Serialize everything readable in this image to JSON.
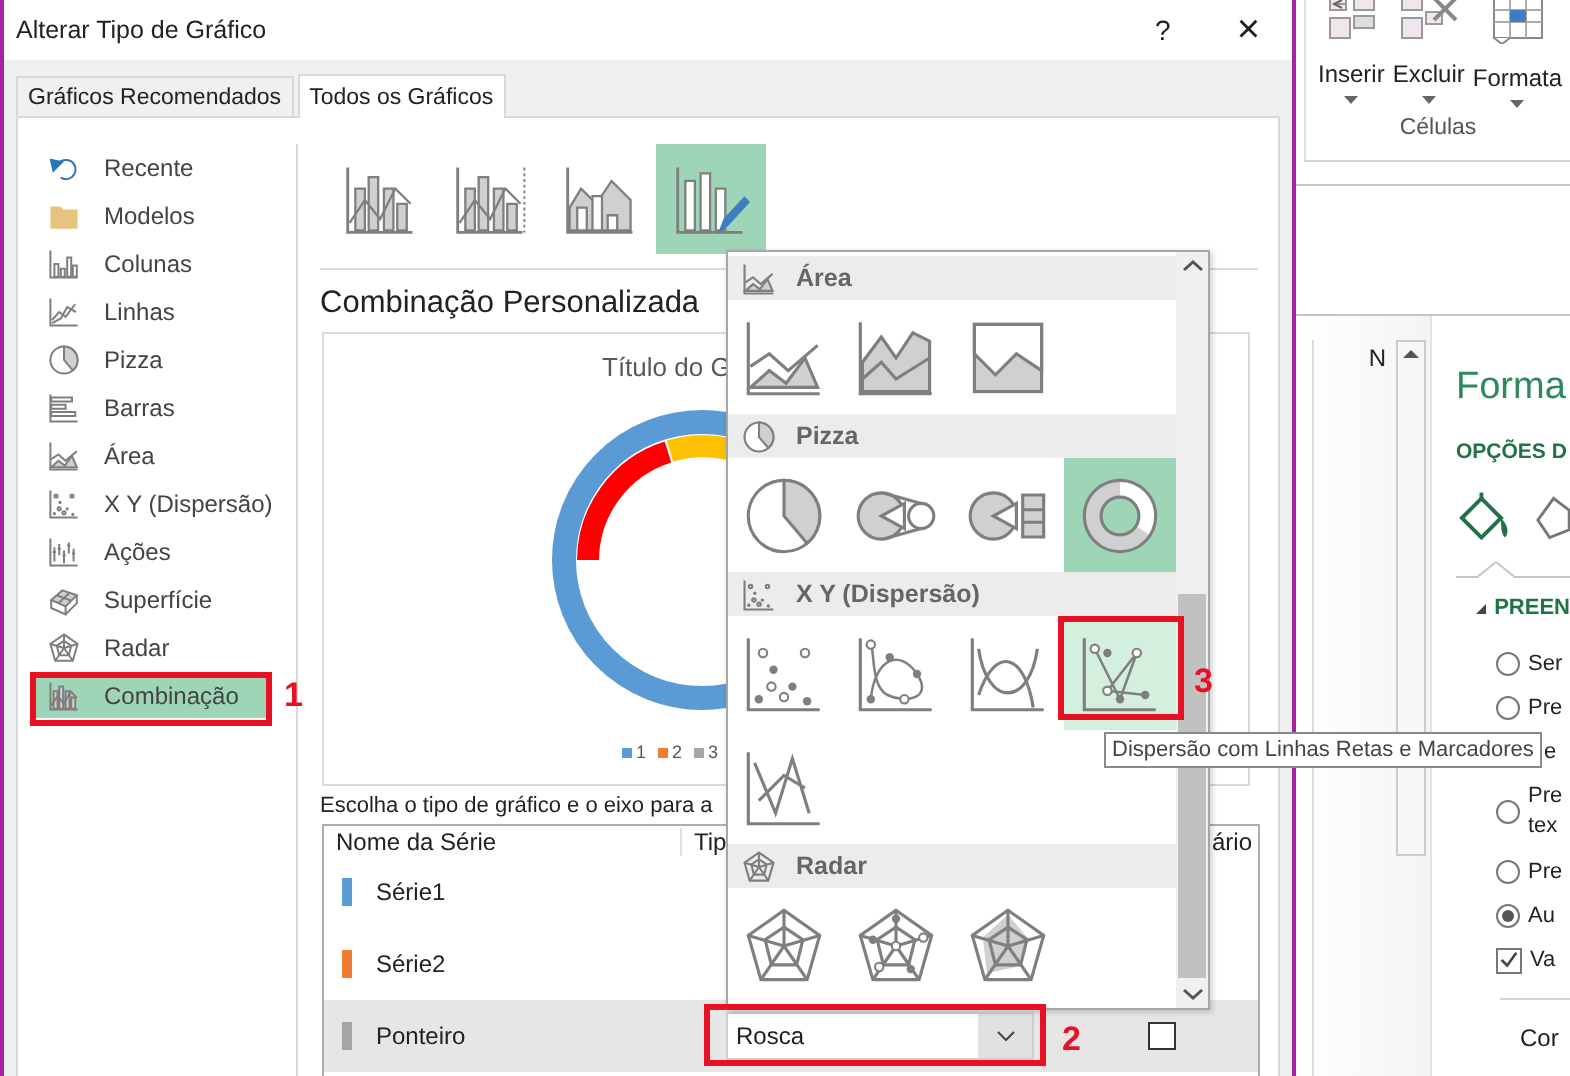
{
  "window": {
    "title": "Alterar Tipo de Gráfico",
    "help": "?",
    "close": "×"
  },
  "tabs": [
    {
      "label": "Gráficos Recomendados",
      "selected": false
    },
    {
      "label": "Todos os Gráficos",
      "selected": true
    }
  ],
  "sidebar": {
    "items": [
      {
        "label": "Recente",
        "selected": false
      },
      {
        "label": "Modelos",
        "selected": false
      },
      {
        "label": "Colunas",
        "selected": false
      },
      {
        "label": "Linhas",
        "selected": false
      },
      {
        "label": "Pizza",
        "selected": false
      },
      {
        "label": "Barras",
        "selected": false
      },
      {
        "label": "Área",
        "selected": false
      },
      {
        "label": "X Y (Dispersão)",
        "selected": false
      },
      {
        "label": "Ações",
        "selected": false
      },
      {
        "label": "Superfície",
        "selected": false
      },
      {
        "label": "Radar",
        "selected": false
      },
      {
        "label": "Combinação",
        "selected": true
      }
    ]
  },
  "subtypes": [
    {
      "selected": false
    },
    {
      "selected": false
    },
    {
      "selected": false
    },
    {
      "selected": true
    }
  ],
  "section_title": "Combinação Personalizada",
  "preview": {
    "title": "Título do G",
    "legend": [
      {
        "label": "1",
        "color": "#5b9bd5"
      },
      {
        "label": "2",
        "color": "#ed7d31"
      },
      {
        "label": "3",
        "color": "#a5a5a5"
      }
    ]
  },
  "series_prompt": "Escolha o tipo de gráfico e o eixo para a",
  "series_table": {
    "columns": [
      "Nome da Série",
      "Tip",
      "ário"
    ],
    "rows": [
      {
        "name": "Série1",
        "color": "#5b9bd5",
        "selected": false
      },
      {
        "name": "Série2",
        "color": "#ed7d31",
        "selected": false
      },
      {
        "name": "Ponteiro",
        "color": "#a5a5a5",
        "selected": true,
        "chart_type": "Rosca",
        "secondary_axis": false
      }
    ]
  },
  "dropdown": {
    "groups": [
      {
        "label": "Área",
        "options": [
          {
            "selected": false,
            "hovered": false
          },
          {
            "selected": false,
            "hovered": false
          },
          {
            "selected": false,
            "hovered": false
          }
        ]
      },
      {
        "label": "Pizza",
        "options": [
          {
            "selected": false,
            "hovered": false
          },
          {
            "selected": false,
            "hovered": false
          },
          {
            "selected": false,
            "hovered": false
          },
          {
            "selected": true,
            "hovered": false
          }
        ]
      },
      {
        "label": "X Y (Dispersão)",
        "options": [
          {
            "selected": false,
            "hovered": false
          },
          {
            "selected": false,
            "hovered": false
          },
          {
            "selected": false,
            "hovered": false
          },
          {
            "selected": false,
            "hovered": true
          },
          {
            "selected": false,
            "hovered": false
          }
        ]
      },
      {
        "label": "Radar",
        "options": [
          {
            "selected": false,
            "hovered": false
          },
          {
            "selected": false,
            "hovered": false
          },
          {
            "selected": false,
            "hovered": false
          }
        ]
      }
    ]
  },
  "tooltip": "Dispersão com Linhas Retas e Marcadores",
  "annotations": [
    {
      "label": "1"
    },
    {
      "label": "2"
    },
    {
      "label": "3"
    }
  ],
  "excel": {
    "ribbon": {
      "buttons": [
        "Inserir",
        "Excluir",
        "Formata"
      ],
      "group": "Células"
    },
    "column_header": "N",
    "pane": {
      "title": "Forma",
      "tab": "OPÇÕES D",
      "section": "PREEN",
      "options": [
        {
          "kind": "radio",
          "lines": [
            "Ser"
          ],
          "checked": false
        },
        {
          "kind": "radio",
          "lines": [
            "Pre"
          ],
          "checked": false
        },
        {
          "kind": "text",
          "lines": [
            "e"
          ]
        },
        {
          "kind": "radio",
          "lines": [
            "Pre",
            "tex"
          ],
          "checked": false
        },
        {
          "kind": "radio",
          "lines": [
            "Pre"
          ],
          "checked": false
        },
        {
          "kind": "radio",
          "lines": [
            "Au"
          ],
          "checked": true
        },
        {
          "kind": "checkbox",
          "lines": [
            "Va"
          ],
          "checked": true
        }
      ],
      "color_label": "Cor"
    }
  }
}
